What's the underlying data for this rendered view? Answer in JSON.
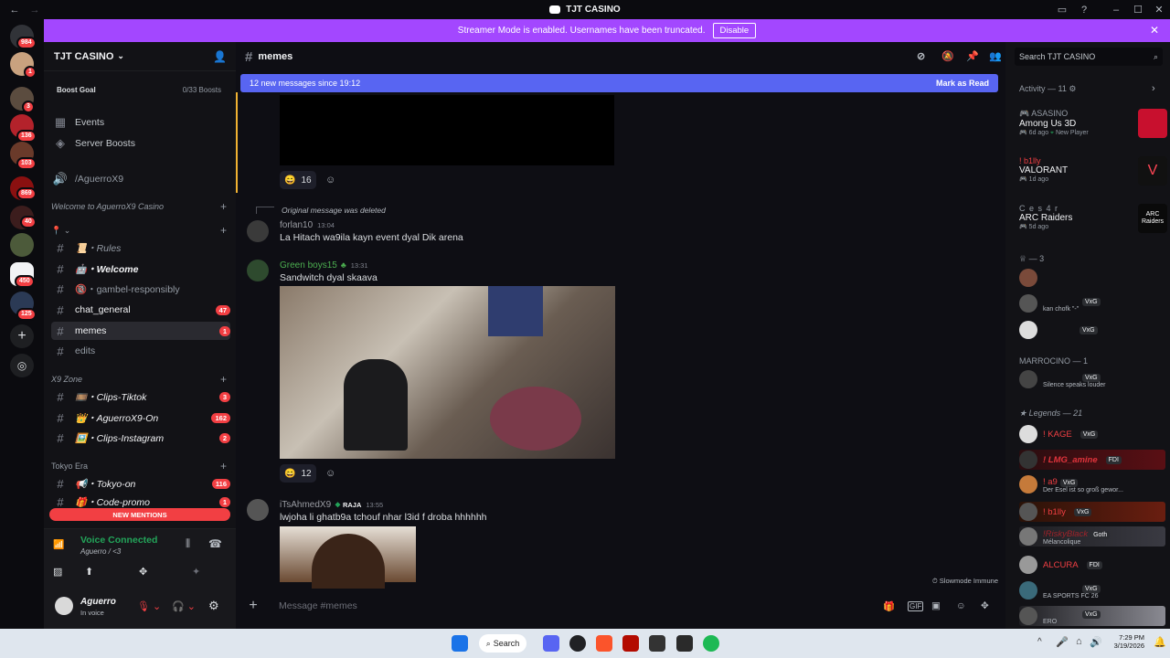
{
  "window": {
    "title": "TJT CASINO"
  },
  "banner": {
    "text": "Streamer Mode is enabled. Usernames have been truncated.",
    "button": "Disable"
  },
  "guilds": {
    "badges": [
      "984",
      "1",
      "3",
      "136",
      "103",
      "869",
      "40",
      "450",
      "125"
    ]
  },
  "sidebar": {
    "server_name": "TJT CASINO",
    "boost_goal": "Boost Goal",
    "boost_count": "0/33 Boosts",
    "events": "Events",
    "server_boosts": "Server Boosts",
    "aguerro": "/AguerroX9",
    "categories": {
      "welcome": "Welcome to AguerroX9 Casino",
      "pin": "📍 ⌄",
      "x9zone": "X9 Zone",
      "tokyo": "Tokyo Era"
    },
    "channels": [
      {
        "label": "📜・Rules",
        "count": ""
      },
      {
        "label": "🤖・Welcome",
        "count": ""
      },
      {
        "label": "🔞・gambel-responsibly",
        "count": ""
      },
      {
        "label": "chat_general",
        "count": "47"
      },
      {
        "label": "memes",
        "count": "1"
      },
      {
        "label": "edits",
        "count": ""
      },
      {
        "label": "🎞️・Clips-Tiktok",
        "count": "3"
      },
      {
        "label": "👑・AguerroX9-On",
        "count": "162"
      },
      {
        "label": "🖼️・Clips-Instagram",
        "count": "2"
      },
      {
        "label": "📢・Tokyo-on",
        "count": "116"
      },
      {
        "label": "🎁・Code-promo",
        "count": "1"
      }
    ],
    "new_mentions": "NEW MENTIONS",
    "voice_connected": "Voice Connected",
    "voice_channel": "Aguerro / <3",
    "user_name": "Aguerro",
    "user_status": "In voice"
  },
  "channel": {
    "name": "memes",
    "new_messages": "12 new messages since 19:12",
    "mark_as_read": "Mark as Read",
    "reactions": [
      "16",
      "12"
    ],
    "deleted_note": "Original message was deleted",
    "messages": [
      {
        "author": "forlan10",
        "time": "13:04",
        "text": "La Hitach wa9ila kayn event dyal Dik arena"
      },
      {
        "author": "Green boys15",
        "time": "13:31",
        "text": "Sandwitch dyal skaava"
      },
      {
        "author": "iTsAhmedX9",
        "tag": "RAJA",
        "time": "13:55",
        "text": "lwjoha li ghatb9a tchouf nhar l3id f droba hhhhhh"
      }
    ],
    "slowmode": "Slowmode Immune",
    "composer_placeholder": "Message #memes"
  },
  "members": {
    "search_placeholder": "Search TJT CASINO",
    "activity_header": "Activity — 11",
    "activities": [
      {
        "user": "ASASINO",
        "game": "Among Us 3D",
        "status": "6d ago",
        "extra": "New Player"
      },
      {
        "user": "! b1lly",
        "game": "VALORANT",
        "status": "1d ago",
        "extra": ""
      },
      {
        "user": "C e s 4 r",
        "game": "ARC Raiders",
        "status": "5d ago",
        "extra": ""
      }
    ],
    "group1": "— 3",
    "group2": "MARROCINO — 1",
    "group3": "Legends — 21",
    "rows": [
      {
        "name": "",
        "tag": "VxG",
        "sub": "kan chofk \"-\""
      },
      {
        "name": "",
        "tag": "VxG",
        "sub": ""
      },
      {
        "name": "",
        "tag": "VxG",
        "sub": "Silence speaks louder"
      },
      {
        "name": "! KAGE",
        "tag": "VxG",
        "sub": ""
      },
      {
        "name": "! LMG_amine",
        "tag": "FDI",
        "sub": ""
      },
      {
        "name": "! a9",
        "tag": "VxG",
        "sub": "Der Esel ist so groß gewor..."
      },
      {
        "name": "! b1lly",
        "tag": "VxG",
        "sub": ""
      },
      {
        "name": "!RiskyBlack",
        "tag": "Goth",
        "sub": "Mélancolique"
      },
      {
        "name": "ALCURA",
        "tag": "FDI",
        "sub": ""
      },
      {
        "name": "",
        "tag": "VxG",
        "sub": "EA SPORTS FC 26"
      },
      {
        "name": "",
        "tag": "VxG",
        "sub": "ERO"
      }
    ]
  },
  "taskbar": {
    "search": "Search",
    "time": "7:29 PM",
    "date": "3/19/2026"
  },
  "colors": {
    "accent": "#a347ff",
    "blurple": "#5865f2",
    "red": "#f23f43"
  }
}
